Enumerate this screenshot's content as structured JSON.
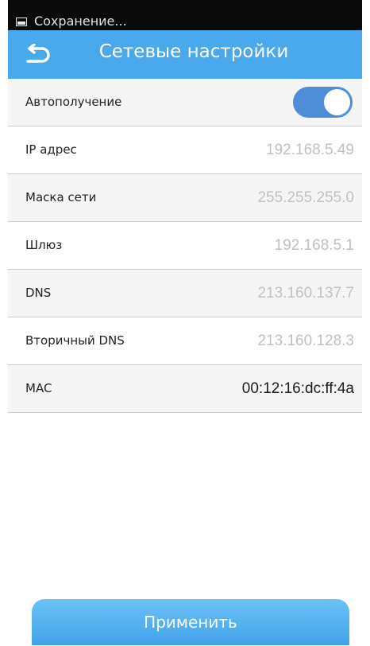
{
  "status_bar": {
    "notification_text": "Сохранение...",
    "icon": "image-icon"
  },
  "header": {
    "title": "Сетевые настройки",
    "back_icon": "back-arrow-icon"
  },
  "settings": [
    {
      "label": "Автополучение",
      "type": "toggle",
      "toggle_on": true
    },
    {
      "label": "IP адрес",
      "value": "192.168.5.49"
    },
    {
      "label": "Маска сети",
      "value": "255.255.255.0"
    },
    {
      "label": "Шлюз",
      "value": "192.168.5.1"
    },
    {
      "label": "DNS",
      "value": "213.160.137.7"
    },
    {
      "label": "Вторичный DNS",
      "value": "213.160.128.3"
    },
    {
      "label": "MAC",
      "value": "00:12:16:dc:ff:4a"
    }
  ],
  "apply_button": {
    "label": "Применить"
  },
  "colors": {
    "header_bg": "#4aa8ec",
    "toggle_on": "#4f8ed6",
    "button_bg": "#4aa8ec",
    "value_text": "#c0c0c0"
  }
}
